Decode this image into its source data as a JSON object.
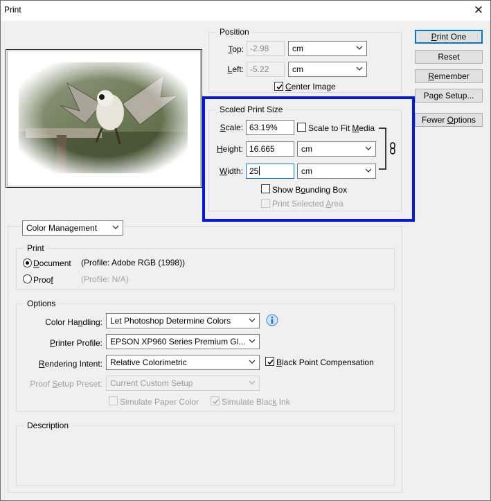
{
  "window": {
    "title": "Print",
    "close_glyph": "✕"
  },
  "buttons": {
    "print_one": "Print One",
    "reset": "Reset",
    "remember": "Remember",
    "page_setup": "Page Setup...",
    "fewer_options": "Fewer Options"
  },
  "position": {
    "legend": "Position",
    "top_label": "Top:",
    "top_value": "-2.98",
    "top_unit": "cm",
    "left_label": "Left:",
    "left_value": "-5.22",
    "left_unit": "cm",
    "center_image_label": "Center Image",
    "center_image_checked": true
  },
  "scaled_print_size": {
    "legend": "Scaled Print Size",
    "scale_label": "Scale:",
    "scale_value": "63.19%",
    "scale_to_fit_label": "Scale to Fit Media",
    "scale_to_fit_checked": false,
    "height_label": "Height:",
    "height_value": "16.665",
    "height_unit": "cm",
    "width_label": "Width:",
    "width_value": "25",
    "width_unit": "cm",
    "show_bounding_box_label": "Show Bounding Box",
    "show_bounding_box_checked": false,
    "print_selected_area_label": "Print Selected Area",
    "link_icon": "chain-link-icon",
    "highlight_color": "#0019e6"
  },
  "color_management": {
    "section_select": "Color Management",
    "print_group": {
      "legend": "Print",
      "document_label": "Document",
      "document_profile": "(Profile: Adobe RGB (1998))",
      "proof_label": "Proof",
      "proof_profile": "(Profile: N/A)",
      "selected": "Document"
    },
    "options_group": {
      "legend": "Options",
      "color_handling_label": "Color Handling:",
      "color_handling_value": "Let Photoshop Determine Colors",
      "info_icon": "info-icon",
      "printer_profile_label": "Printer Profile:",
      "printer_profile_value": "EPSON XP960 Series Premium Gl...",
      "rendering_intent_label": "Rendering Intent:",
      "rendering_intent_value": "Relative Colorimetric",
      "black_point_label": "Black Point Compensation",
      "black_point_checked": true,
      "proof_setup_label": "Proof Setup Preset:",
      "proof_setup_value": "Current Custom Setup",
      "simulate_paper_label": "Simulate Paper Color",
      "simulate_black_label": "Simulate Black Ink",
      "simulate_black_checked": true
    },
    "description_legend": "Description"
  },
  "preview": {
    "image_name": "owl-in-flight-photo"
  }
}
